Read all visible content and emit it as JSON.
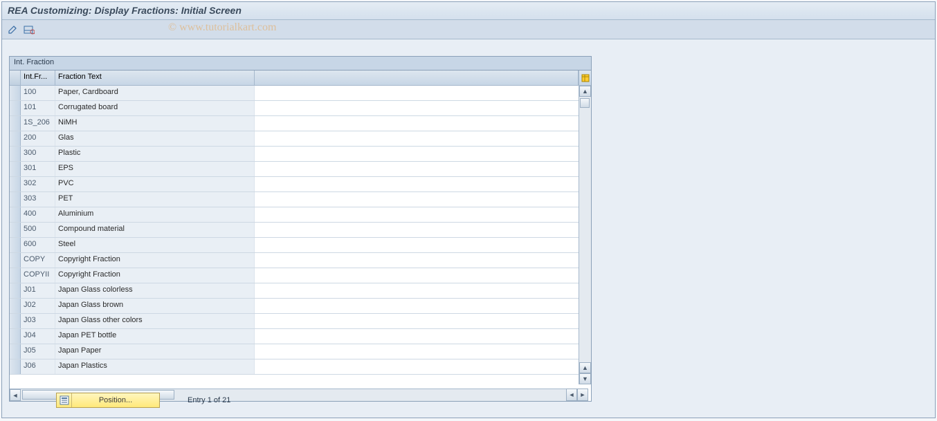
{
  "title": "REA Customizing: Display Fractions: Initial Screen",
  "watermark": "© www.tutorialkart.com",
  "panel": {
    "title": "Int. Fraction"
  },
  "columns": {
    "intfr": "Int.Fr...",
    "text": "Fraction Text"
  },
  "rows": [
    {
      "intfr": "100",
      "text": "Paper, Cardboard"
    },
    {
      "intfr": "101",
      "text": "Corrugated board"
    },
    {
      "intfr": "1S_206",
      "text": "NiMH"
    },
    {
      "intfr": "200",
      "text": "Glas"
    },
    {
      "intfr": "300",
      "text": "Plastic"
    },
    {
      "intfr": "301",
      "text": "EPS"
    },
    {
      "intfr": "302",
      "text": "PVC"
    },
    {
      "intfr": "303",
      "text": "PET"
    },
    {
      "intfr": "400",
      "text": "Aluminium"
    },
    {
      "intfr": "500",
      "text": "Compound material"
    },
    {
      "intfr": "600",
      "text": "Steel"
    },
    {
      "intfr": "COPY",
      "text": "Copyright Fraction"
    },
    {
      "intfr": "COPYII",
      "text": "Copyright Fraction"
    },
    {
      "intfr": "J01",
      "text": "Japan Glass colorless"
    },
    {
      "intfr": "J02",
      "text": "Japan Glass brown"
    },
    {
      "intfr": "J03",
      "text": "Japan Glass other colors"
    },
    {
      "intfr": "J04",
      "text": "Japan PET bottle"
    },
    {
      "intfr": "J05",
      "text": "Japan Paper"
    },
    {
      "intfr": "J06",
      "text": "Japan Plastics"
    }
  ],
  "footer": {
    "position_label": "Position...",
    "entry_text": "Entry 1 of 21"
  }
}
